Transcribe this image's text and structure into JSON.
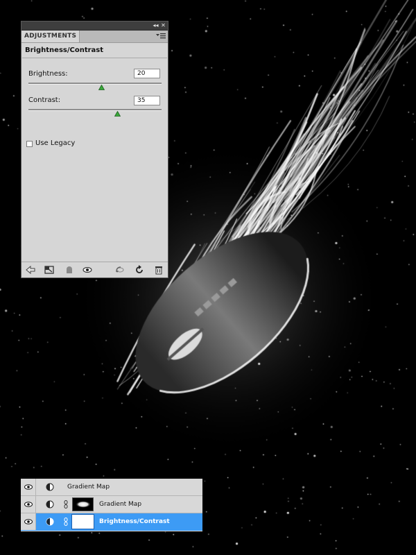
{
  "panel": {
    "tab_label": "ADJUSTMENTS",
    "title": "Brightness/Contrast",
    "controls": {
      "brightness": {
        "label": "Brightness:",
        "value": "20",
        "fraction": 0.55
      },
      "contrast": {
        "label": "Contrast:",
        "value": "35",
        "fraction": 0.67
      }
    },
    "use_legacy": {
      "label": "Use Legacy",
      "checked": false
    },
    "strip_icons": [
      "collapse-icon",
      "close-icon"
    ],
    "footer_icons": [
      "back-arrow-icon",
      "expand-view-icon",
      "clip-to-layer-icon",
      "visibility-eye-icon",
      "view-previous-icon",
      "reset-icon",
      "delete-icon"
    ]
  },
  "layers": {
    "rows": [
      {
        "name": "Gradient Map",
        "has_mask": false,
        "selected": false
      },
      {
        "name": "Gradient Map",
        "has_mask": true,
        "mask": "black",
        "selected": false
      },
      {
        "name": "Brightness/Contrast",
        "has_mask": true,
        "mask": "white",
        "selected": true
      }
    ]
  },
  "colors": {
    "selection": "#3d9bf5",
    "panel_bg": "#d6d6d6",
    "slider_thumb": "#39a93a"
  }
}
